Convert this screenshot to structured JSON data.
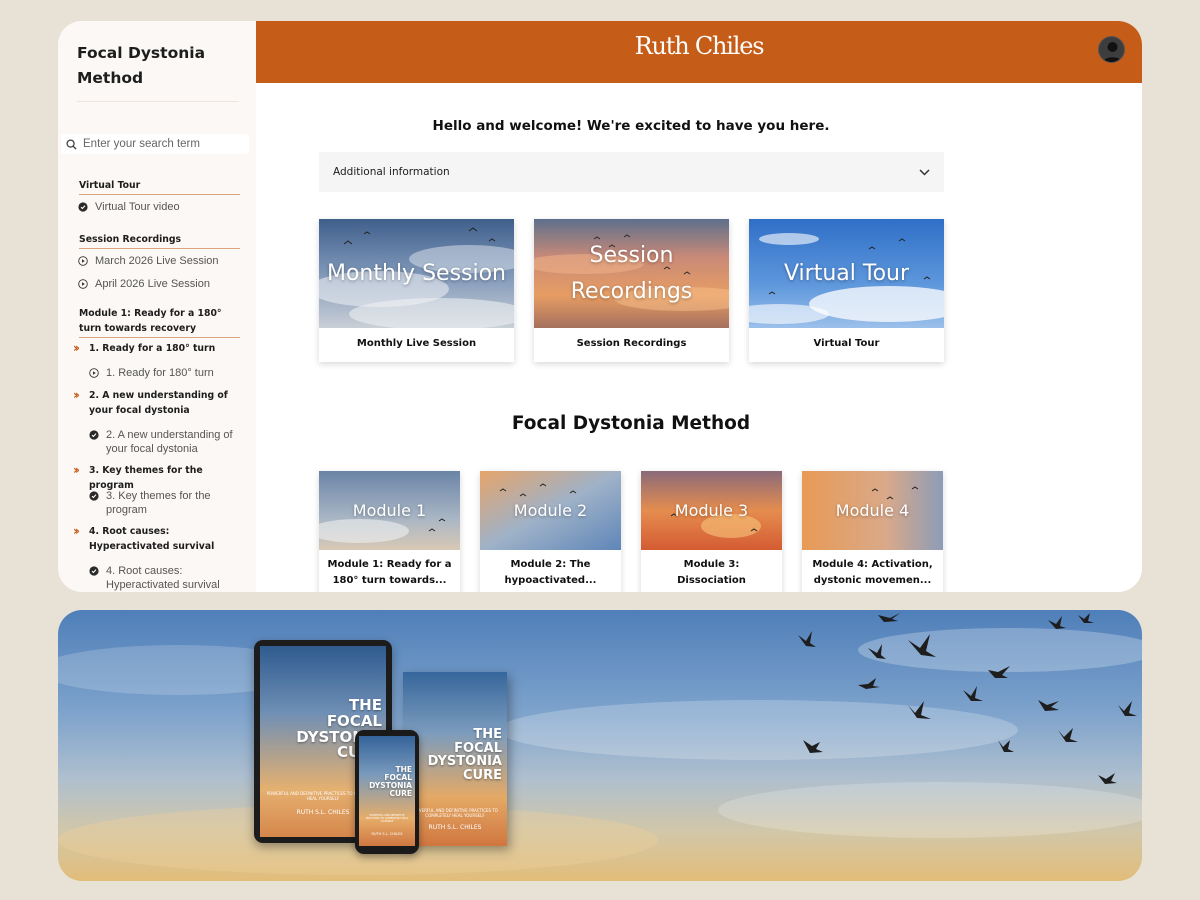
{
  "sidebar": {
    "title": "Focal Dystonia Method",
    "search_placeholder": "Enter your search term",
    "sections": [
      {
        "title": "Virtual Tour",
        "lessons": [
          "Virtual Tour video"
        ]
      },
      {
        "title": "Session Recordings",
        "lessons": [
          "March 2026 Live Session",
          "April 2026 Live Session"
        ]
      },
      {
        "title": "Module 1: Ready for a 180° turn towards recovery",
        "chapters": [
          {
            "title": "1. Ready for a 180° turn",
            "lesson": "1. Ready for 180° turn"
          },
          {
            "title": "2. A new understanding of your focal dystonia",
            "lesson": "2. A new understanding of your focal dystonia"
          },
          {
            "title": "3. Key themes for the program",
            "lesson": "3. Key themes for the program"
          },
          {
            "title": "4. Root causes: Hyperactivated survival",
            "lesson": "4. Root causes: Hyperactivated survival"
          }
        ]
      }
    ]
  },
  "header": {
    "brand": "Ruth Chiles"
  },
  "main": {
    "welcome": "Hello and welcome! We're excited to have you here.",
    "accordion_label": "Additional information",
    "feature_cards": [
      {
        "image_text": "Monthly Session",
        "caption": "Monthly Live Session"
      },
      {
        "image_text_line1": "Session",
        "image_text_line2": "Recordings",
        "caption": "Session Recordings"
      },
      {
        "image_text": "Virtual Tour",
        "caption": "Virtual Tour"
      }
    ],
    "section_title": "Focal Dystonia Method",
    "modules": [
      {
        "image_text": "Module 1",
        "caption_line1": "Module 1: Ready for a",
        "caption_line2": "180° turn towards..."
      },
      {
        "image_text": "Module 2",
        "caption_line1": "Module 2: The",
        "caption_line2": "hypoactivated..."
      },
      {
        "image_text": "Module 3",
        "caption_line1": "Module 3:",
        "caption_line2": "Dissociation"
      },
      {
        "image_text": "Module 4",
        "caption_line1": "Module 4: Activation,",
        "caption_line2": "dystonic movemen..."
      }
    ]
  },
  "banner": {
    "book": {
      "title_lines": [
        "THE",
        "FOCAL",
        "DYSTONIA",
        "CURE"
      ],
      "subtitle": "POWERFUL AND DEFINITIVE PRACTICES TO COMPLETELY HEAL YOURSELF",
      "author": "RUTH S.L. CHILES"
    }
  },
  "colors": {
    "accent": "#c55c17",
    "chevron": "#c85b1a",
    "section_rule": "#d9a57e"
  }
}
